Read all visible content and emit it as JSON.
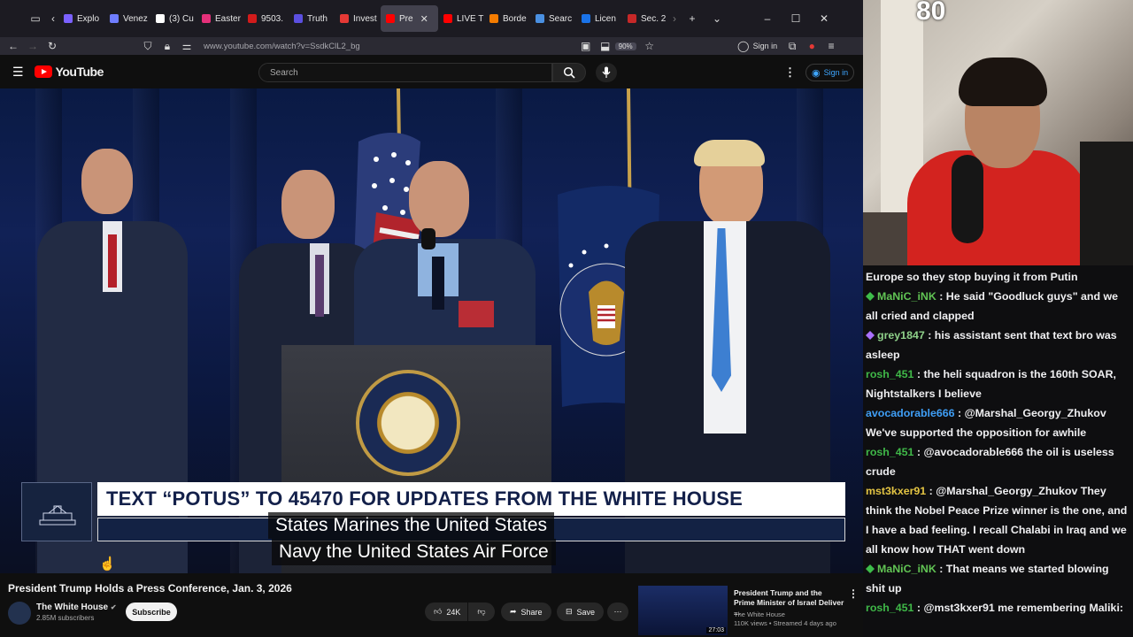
{
  "browser": {
    "tabs": [
      {
        "label": "Explo",
        "color": "#7b61ff"
      },
      {
        "label": "Venez",
        "color": "#6f7dff"
      },
      {
        "label": "(3) Cu",
        "color": "#ffffff"
      },
      {
        "label": "Easter",
        "color": "#e5307a"
      },
      {
        "label": "9503.",
        "color": "#d21b1b"
      },
      {
        "label": "Truth",
        "color": "#5b4fe0"
      },
      {
        "label": "Invest",
        "color": "#e53935"
      },
      {
        "label": "Pre",
        "color": "#ff0000",
        "active": true
      },
      {
        "label": "LIVE T",
        "color": "#ff0000"
      },
      {
        "label": "Borde",
        "color": "#f57c00"
      },
      {
        "label": "Searc",
        "color": "#4a90e2"
      },
      {
        "label": "Licen",
        "color": "#1a73e8"
      },
      {
        "label": "Sec. 2",
        "color": "#c62828"
      }
    ],
    "url": "www.youtube.com/watch?v=SsdkClL2_bg",
    "zoom": "90%",
    "sign_in": "Sign in"
  },
  "youtube": {
    "logo_text": "YouTube",
    "search_placeholder": "Search",
    "sign_in": "Sign in",
    "video": {
      "banner_text": "TEXT “POTUS” TO 45470 FOR UPDATES FROM THE WHITE HOUSE",
      "caption_line1": "States Marines the United States",
      "caption_line2": "Navy the United States Air Force"
    },
    "title": "President Trump Holds a Press Conference, Jan. 3, 2026",
    "channel": {
      "name": "The White House",
      "subscribers": "2.85M subscribers"
    },
    "subscribe": "Subscribe",
    "likes": "24K",
    "share": "Share",
    "save": "Save",
    "recommended": {
      "title": "President Trump and the Prime Minister of Israel Deliver ...",
      "channel": "The White House",
      "meta": "110K views • Streamed 4 days ago",
      "duration": "27:03"
    }
  },
  "stream": {
    "overlay_number": "80",
    "chat": [
      {
        "user": "",
        "user_color": "#efeff1",
        "text": "Europe so they stop buying it from Putin",
        "badge": ""
      },
      {
        "user": "MaNiC_iNK",
        "user_color": "#61c454",
        "text": "He said \"Goodluck guys\" and we all cried and clapped",
        "badge": "#3dbd4a"
      },
      {
        "user": "grey1847",
        "user_color": "#8fd18a",
        "text": "his assistant sent that text bro was asleep",
        "badge": "#a970ff"
      },
      {
        "user": "rosh_451",
        "user_color": "#3fb848",
        "text": "the heli squadron is the 160th SOAR, Nightstalkers I believe",
        "badge": ""
      },
      {
        "user": "avocadorable666",
        "user_color": "#3f9ef5",
        "text": "@Marshal_Georgy_Zhukov We've supported the opposition for awhile",
        "badge": ""
      },
      {
        "user": "rosh_451",
        "user_color": "#3fb848",
        "text": "@avocadorable666 the oil is useless crude",
        "badge": ""
      },
      {
        "user": "mst3kxer91",
        "user_color": "#e3c443",
        "text": "@Marshal_Georgy_Zhukov They think the Nobel Peace Prize winner is the one, and I have a bad feeling. I recall Chalabi in Iraq and we all know how THAT went down",
        "badge": ""
      },
      {
        "user": "MaNiC_iNK",
        "user_color": "#61c454",
        "text": "That means we started blowing shit up",
        "badge": "#3dbd4a"
      },
      {
        "user": "rosh_451",
        "user_color": "#3fb848",
        "text": "@mst3kxer91 me remembering Maliki:",
        "badge": ""
      }
    ]
  }
}
